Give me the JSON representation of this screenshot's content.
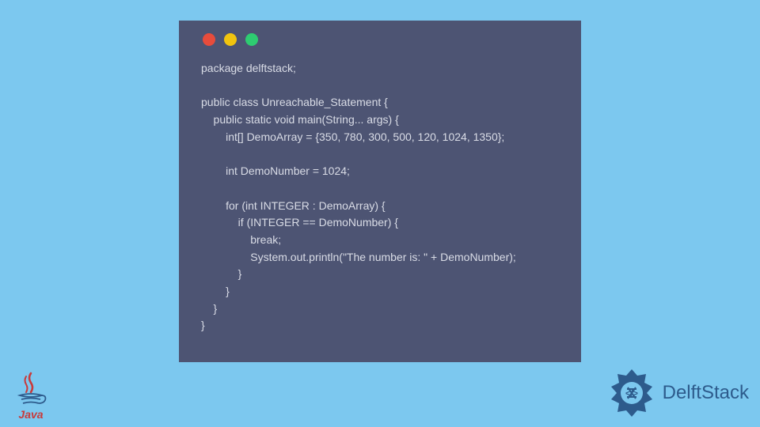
{
  "code": {
    "line1": "package delftstack;",
    "line2": "",
    "line3": "public class Unreachable_Statement {",
    "line4": "    public static void main(String... args) {",
    "line5": "        int[] DemoArray = {350, 780, 300, 500, 120, 1024, 1350};",
    "line6": "",
    "line7": "        int DemoNumber = 1024;",
    "line8": "",
    "line9": "        for (int INTEGER : DemoArray) {",
    "line10": "            if (INTEGER == DemoNumber) {",
    "line11": "                break;",
    "line12": "                System.out.println(\"The number is: \" + DemoNumber);",
    "line13": "            }",
    "line14": "        }",
    "line15": "    }",
    "line16": "}"
  },
  "logos": {
    "java_text": "Java",
    "delftstack_text": "DelftStack"
  }
}
